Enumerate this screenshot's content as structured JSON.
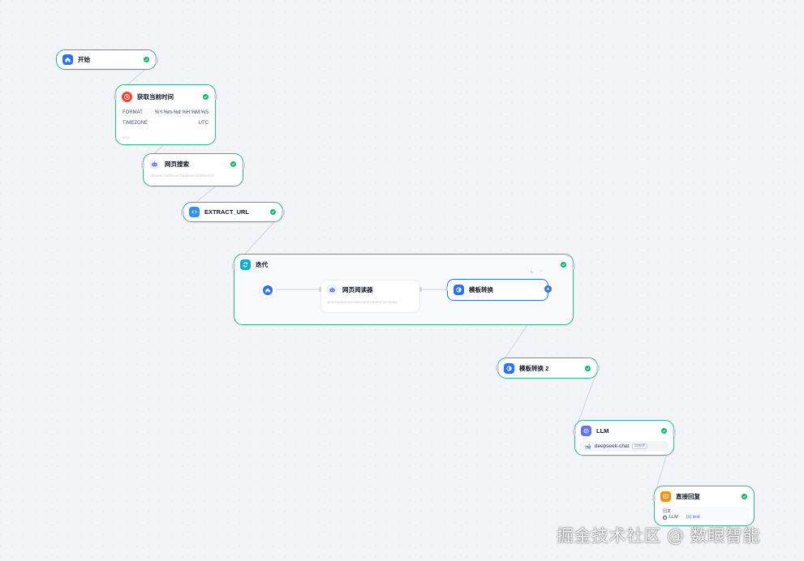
{
  "colors": {
    "canvas_bg": "#f2f4f7",
    "node_border": "#31b58a",
    "success": "#12b76a",
    "edge": "#d0d5dd",
    "selected_border": "#2970ff",
    "icon_blue": "#2970ff",
    "icon_orange": "#f04438",
    "icon_teal": "#06aed4",
    "icon_indigo": "#6172f3",
    "icon_amber": "#f79009"
  },
  "nodes": {
    "start": {
      "title": "开始",
      "icon": "home-icon"
    },
    "get_time": {
      "title": "获取当前时间",
      "icon": "clock-icon",
      "params": [
        {
          "key": "FORMAT",
          "value": "%Y-%m-%d %H:%M:%S"
        },
        {
          "key": "TIMEZONE",
          "value": "UTC"
        }
      ],
      "footer": "time"
    },
    "web_search": {
      "title": "网页搜索",
      "icon": "robot-icon",
      "footer": "ddsearchddsearchddsearchddsearch"
    },
    "extract_url": {
      "title": "EXTRACT_URL",
      "icon": "code-icon"
    },
    "iteration": {
      "title": "迭代",
      "icon": "loop-icon",
      "children": {
        "web_reader": {
          "title": "网页阅读器",
          "icon": "robot-icon",
          "footer": "jinareaderjinareaderjinareaderjinareader"
        },
        "template": {
          "title": "模板转换",
          "icon": "template-icon"
        }
      }
    },
    "template2": {
      "title": "模板转换 2",
      "icon": "template-icon"
    },
    "llm": {
      "title": "LLM",
      "icon": "llm-icon",
      "model": "deepseek-chat",
      "mode": "CHAT"
    },
    "answer": {
      "title": "直接回复",
      "icon": "reply-icon",
      "label": "回复",
      "var_source": "LLM",
      "var_name": "{x} text"
    }
  },
  "watermark": "掘金技术社区 @ 数眼智能"
}
